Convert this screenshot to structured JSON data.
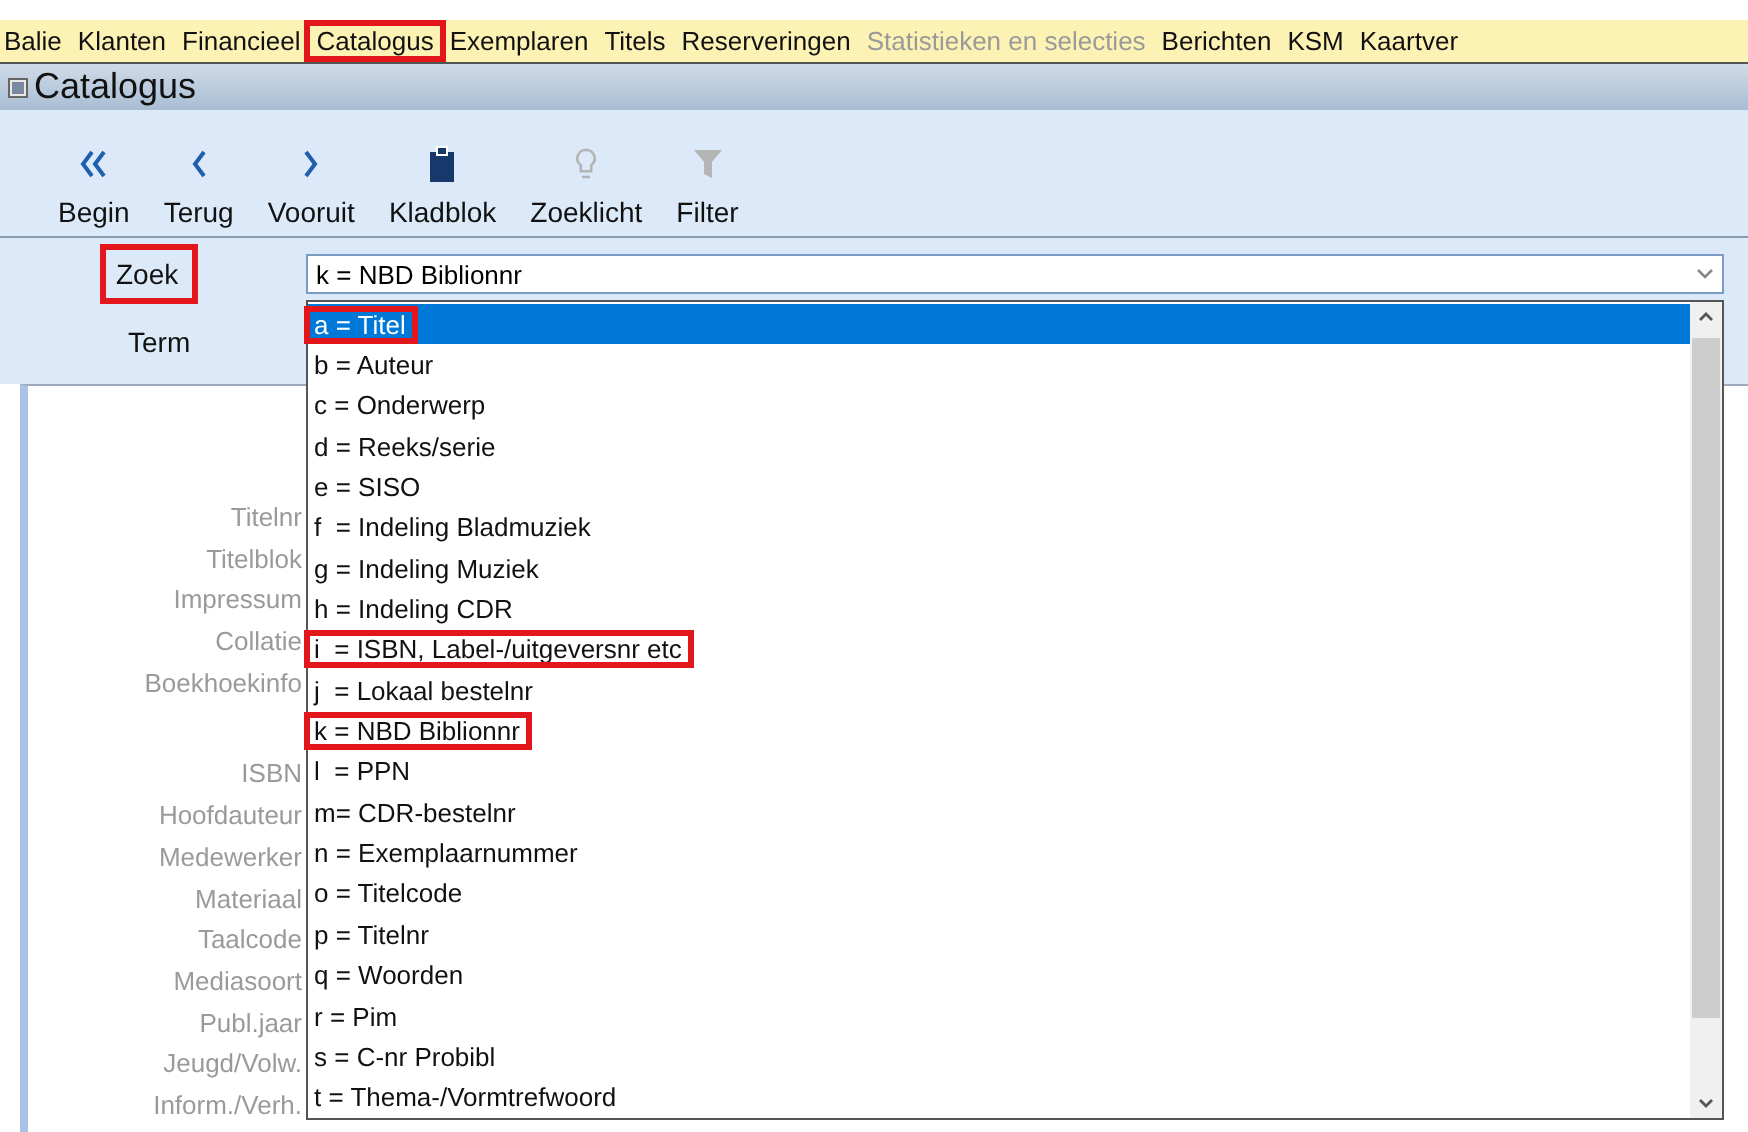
{
  "menu": [
    {
      "label": "Balie",
      "disabled": false,
      "highlighted": false
    },
    {
      "label": "Klanten",
      "disabled": false,
      "highlighted": false
    },
    {
      "label": "Financieel",
      "disabled": false,
      "highlighted": false
    },
    {
      "label": "Catalogus",
      "disabled": false,
      "highlighted": true
    },
    {
      "label": "Exemplaren",
      "disabled": false,
      "highlighted": false
    },
    {
      "label": "Titels",
      "disabled": false,
      "highlighted": false
    },
    {
      "label": "Reserveringen",
      "disabled": false,
      "highlighted": false
    },
    {
      "label": "Statistieken en selecties",
      "disabled": true,
      "highlighted": false
    },
    {
      "label": "Berichten",
      "disabled": false,
      "highlighted": false
    },
    {
      "label": "KSM",
      "disabled": false,
      "highlighted": false
    },
    {
      "label": "Kaartver",
      "disabled": false,
      "highlighted": false
    }
  ],
  "window": {
    "title": "Catalogus"
  },
  "toolbar": [
    {
      "label": "Begin",
      "kind": "first",
      "enabled": true
    },
    {
      "label": "Terug",
      "kind": "back",
      "enabled": true
    },
    {
      "label": "Vooruit",
      "kind": "forward",
      "enabled": true
    },
    {
      "label": "Kladblok",
      "kind": "clipboard",
      "enabled": true
    },
    {
      "label": "Zoeklicht",
      "kind": "bulb",
      "enabled": false
    },
    {
      "label": "Filter",
      "kind": "funnel",
      "enabled": false
    }
  ],
  "search": {
    "zoek_label": {
      "label": "Zoek",
      "highlighted": true
    },
    "zoek_value": "k = NBD Biblionnr",
    "term_label": {
      "label": "Term",
      "highlighted": false
    }
  },
  "field_groups": [
    [
      "Titelnr",
      "Titelblok",
      "Impressum",
      "Collatie",
      "Boekhoekinfo"
    ],
    [
      "ISBN",
      "Hoofdauteur",
      "Medewerker",
      "Materiaal",
      "Taalcode",
      "Mediasoort",
      "Publ.jaar",
      "Jeugd/Volw.",
      "Inform./Verh."
    ]
  ],
  "dropdown": [
    {
      "label": "a = Titel",
      "selected": true,
      "highlighted": true
    },
    {
      "label": "b = Auteur",
      "selected": false,
      "highlighted": false
    },
    {
      "label": "c = Onderwerp",
      "selected": false,
      "highlighted": false
    },
    {
      "label": "d = Reeks/serie",
      "selected": false,
      "highlighted": false
    },
    {
      "label": "e = SISO",
      "selected": false,
      "highlighted": false
    },
    {
      "label": "f  = Indeling Bladmuziek",
      "selected": false,
      "highlighted": false
    },
    {
      "label": "g = Indeling Muziek",
      "selected": false,
      "highlighted": false
    },
    {
      "label": "h = Indeling CDR",
      "selected": false,
      "highlighted": false
    },
    {
      "label": "i  = ISBN, Label-/uitgeversnr etc",
      "selected": false,
      "highlighted": true
    },
    {
      "label": "j  = Lokaal bestelnr",
      "selected": false,
      "highlighted": false
    },
    {
      "label": "k = NBD Biblionnr",
      "selected": false,
      "highlighted": true
    },
    {
      "label": "l  = PPN",
      "selected": false,
      "highlighted": false
    },
    {
      "label": "m= CDR-bestelnr",
      "selected": false,
      "highlighted": false
    },
    {
      "label": "n = Exemplaarnummer",
      "selected": false,
      "highlighted": false
    },
    {
      "label": "o = Titelcode",
      "selected": false,
      "highlighted": false
    },
    {
      "label": "p = Titelnr",
      "selected": false,
      "highlighted": false
    },
    {
      "label": "q = Woorden",
      "selected": false,
      "highlighted": false
    },
    {
      "label": "r = Pim",
      "selected": false,
      "highlighted": false
    },
    {
      "label": "s = C-nr Probibl",
      "selected": false,
      "highlighted": false
    },
    {
      "label": "t = Thema-/Vormtrefwoord",
      "selected": false,
      "highlighted": false
    }
  ]
}
